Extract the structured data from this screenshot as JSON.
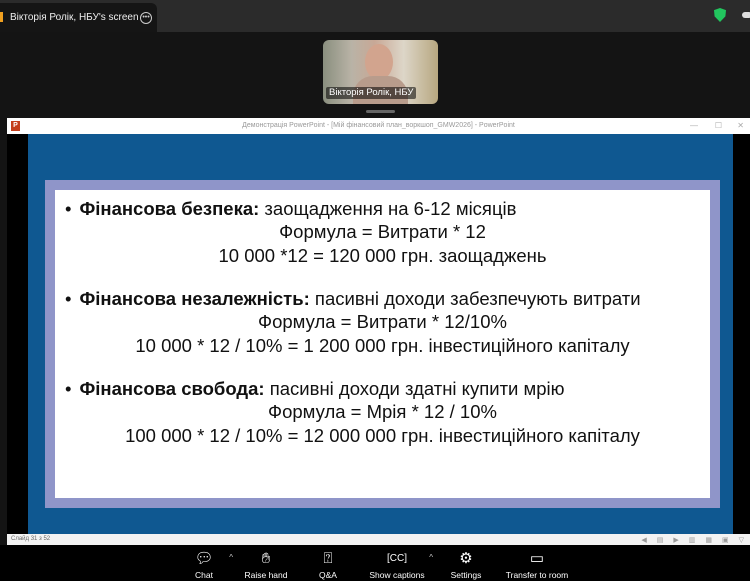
{
  "tab": {
    "title": "Вікторія Ролік, НБУ's screen"
  },
  "video": {
    "name": "Вікторія Ролік, НБУ"
  },
  "ppt": {
    "title": "Демонстрація PowerPoint - [Мій фінансовий план_воркшоп_GMW2026] - PowerPoint",
    "status": "Слайд 31 з 52"
  },
  "slide": {
    "items": [
      {
        "bold": "Фінансова безпека:",
        "text": "заощадження на 6-12 місяців",
        "formula": "Формула = Витрати * 12",
        "example": "10 000 *12 = 120 000 грн. заощаджень"
      },
      {
        "bold": "Фінансова незалежність:",
        "text": "пасивні доходи забезпечують витрати",
        "formula": "Формула = Витрати * 12/10%",
        "example": "10 000 * 12 / 10% = 1 200 000 грн. інвестиційного капіталу"
      },
      {
        "bold": "Фінансова свобода:",
        "text": "пасивні доходи здатні купити мрію",
        "formula": "Формула = Мрія * 12 / 10%",
        "example": "100 000 * 12 / 10% = 12 000 000 грн. інвестиційного капіталу"
      }
    ]
  },
  "toolbar": {
    "chat": "Chat",
    "raise": "Raise hand",
    "qa": "Q&A",
    "captions": "Show captions",
    "settings": "Settings",
    "transfer": "Transfer to room"
  }
}
